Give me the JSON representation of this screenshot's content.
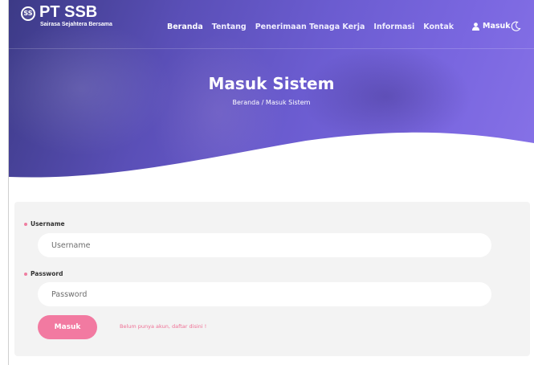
{
  "brand": {
    "logo_text": "SS",
    "name": "PT SSB",
    "tagline": "Sairasa Sejahtera Bersama"
  },
  "nav": {
    "items": [
      {
        "label": "Beranda",
        "active": true
      },
      {
        "label": "Tentang"
      },
      {
        "label": "Penerimaan Tenaga Kerja"
      },
      {
        "label": "Informasi"
      },
      {
        "label": "Kontak"
      }
    ],
    "login_label": "Masuk",
    "user_icon": "user-icon",
    "theme_icon": "moon-icon"
  },
  "hero": {
    "title": "Masuk Sistem",
    "breadcrumb": "Beranda / Masuk Sistem"
  },
  "form": {
    "username_label": "Username",
    "username_placeholder": "Username",
    "password_label": "Password",
    "password_placeholder": "Password",
    "submit_label": "Masuk",
    "register_link": "Belum punya akun, daftar disini !"
  },
  "colors": {
    "accent_pink": "#f27aa1",
    "hero_start": "#3c3a86",
    "hero_end": "#8772e7",
    "card_bg": "#f3f3f3"
  }
}
